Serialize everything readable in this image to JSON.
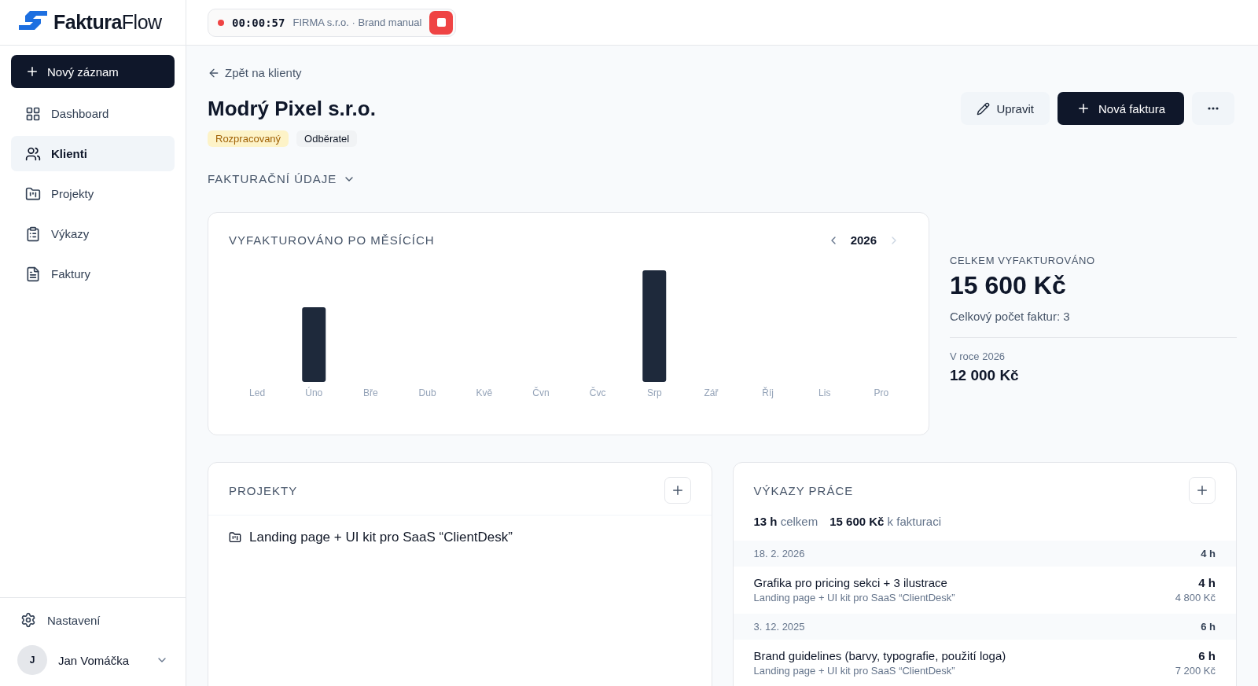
{
  "brand": {
    "name_a": "Faktura",
    "name_b": "Flow"
  },
  "sidebar": {
    "new_button": "Nový záznam",
    "items": [
      {
        "label": "Dashboard",
        "kind": "dashboard",
        "selected": false
      },
      {
        "label": "Klienti",
        "kind": "clients",
        "selected": true
      },
      {
        "label": "Projekty",
        "kind": "projects",
        "selected": false
      },
      {
        "label": "Výkazy",
        "kind": "reports",
        "selected": false
      },
      {
        "label": "Faktury",
        "kind": "invoices",
        "selected": false
      }
    ],
    "settings": "Nastavení",
    "user": {
      "initial": "J",
      "name": "Jan Vomáčka"
    }
  },
  "timer": {
    "time": "00:00:57",
    "description": "FIRMA s.r.o. · Brand manual"
  },
  "back_link": "Zpět na klienty",
  "client": {
    "name": "Modrý Pixel s.r.o.",
    "badges": [
      {
        "label": "Rozpracovaný",
        "color": "#fdf3c8"
      },
      {
        "label": "Odběratel",
        "color": "#f1f3f5"
      }
    ]
  },
  "actions": {
    "edit": "Upravit",
    "new_invoice": "Nová faktura"
  },
  "billing_section": "FAKTURAČNÍ ÚDAJE",
  "chart_card": {
    "title": "VYFAKTUROVÁNO PO MĚSÍCÍCH",
    "year": "2026",
    "months": [
      "Led",
      "Úno",
      "Bře",
      "Dub",
      "Kvě",
      "Čvn",
      "Čvc",
      "Srp",
      "Zář",
      "Říj",
      "Lis",
      "Pro"
    ]
  },
  "totals": {
    "label": "CELKEM VYFAKTUROVÁNO",
    "amount": "15 600 Kč",
    "count": "Celkový počet faktur: 3",
    "year_label": "V roce 2026",
    "year_amount": "12 000 Kč"
  },
  "projects": {
    "title": "PROJEKTY",
    "items": [
      "Landing page + UI kit pro SaaS “ClientDesk”"
    ]
  },
  "worklogs": {
    "title": "VÝKAZY PRÁCE",
    "hours": "13 h",
    "hours_label": "celkem",
    "amount": "15 600 Kč",
    "amount_label": "k fakturaci",
    "days": [
      {
        "date": "18. 2. 2026",
        "total": "4 h",
        "entries": [
          {
            "title": "Grafika pro pricing sekci + 3 ilustrace",
            "project": "Landing page + UI kit pro SaaS “ClientDesk”",
            "hours": "4 h",
            "amount": "4 800 Kč"
          }
        ]
      },
      {
        "date": "3. 12. 2025",
        "total": "6 h",
        "entries": [
          {
            "title": "Brand guidelines (barvy, typografie, použití loga)",
            "project": "Landing page + UI kit pro SaaS “ClientDesk”",
            "hours": "6 h",
            "amount": "7 200 Kč"
          }
        ]
      }
    ]
  }
}
